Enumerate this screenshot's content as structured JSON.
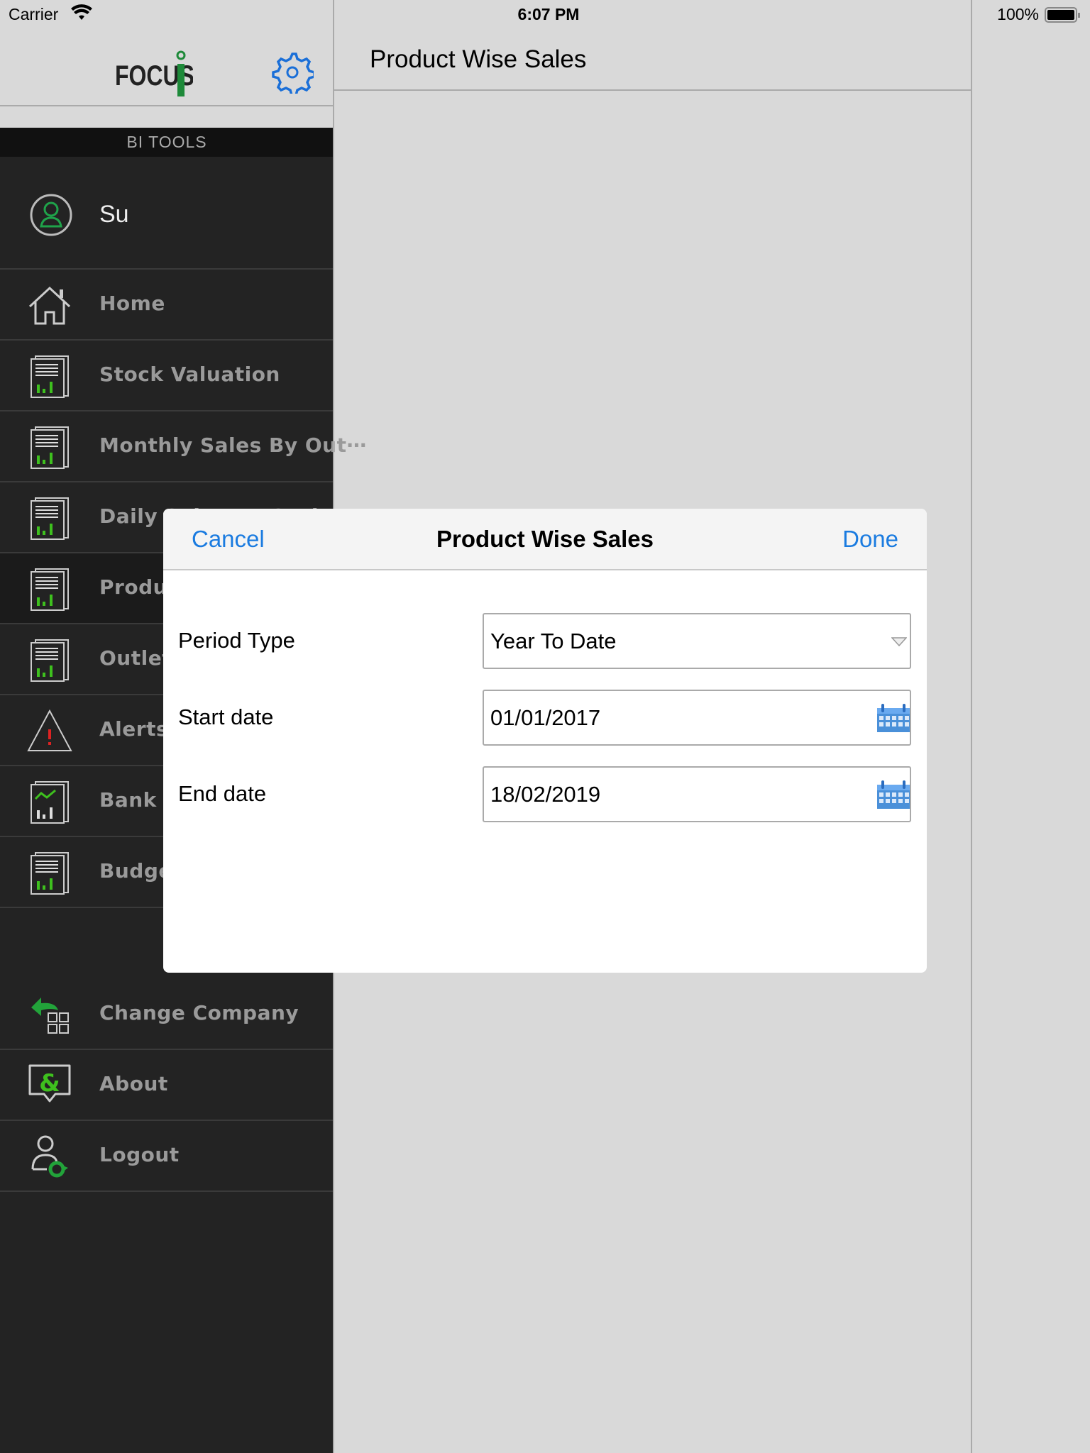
{
  "status_bar": {
    "carrier": "Carrier",
    "time": "6:07 PM",
    "battery": "100%",
    "battery_level": 1.0
  },
  "sidebar": {
    "logo_text": "FOCUS i",
    "section_title": "BI TOOLS",
    "user_name": "Su",
    "items": [
      {
        "label": "Home",
        "icon": "home-icon"
      },
      {
        "label": "Stock Valuation",
        "icon": "report-icon"
      },
      {
        "label": "Monthly Sales By Out⋯",
        "icon": "report-icon"
      },
      {
        "label": "Daily Sales By Outlet",
        "icon": "report-icon"
      },
      {
        "label": "Produc",
        "icon": "report-icon",
        "selected": true
      },
      {
        "label": "Outlet",
        "icon": "report-icon"
      },
      {
        "label": "Alerts",
        "icon": "alert-icon"
      },
      {
        "label": "Bank L",
        "icon": "trend-report-icon"
      },
      {
        "label": "Budget",
        "icon": "report-icon"
      }
    ],
    "bottom_items": [
      {
        "label": "Change Company",
        "icon": "change-company-icon"
      },
      {
        "label": "About",
        "icon": "about-icon"
      },
      {
        "label": "Logout",
        "icon": "logout-icon"
      }
    ]
  },
  "main": {
    "title": "Product Wise Sales"
  },
  "modal": {
    "title": "Product Wise Sales",
    "cancel": "Cancel",
    "done": "Done",
    "fields": [
      {
        "label": "Period Type",
        "value": "Year To Date",
        "type": "dropdown"
      },
      {
        "label": "Start date",
        "value": "01/01/2017",
        "type": "date"
      },
      {
        "label": "End date",
        "value": "18/02/2019",
        "type": "date"
      }
    ]
  },
  "colors": {
    "accent": "#1a7be0",
    "brand_green": "#1e8a3a",
    "sidebar_bg": "#232323",
    "icon_green": "#3ec01e"
  }
}
